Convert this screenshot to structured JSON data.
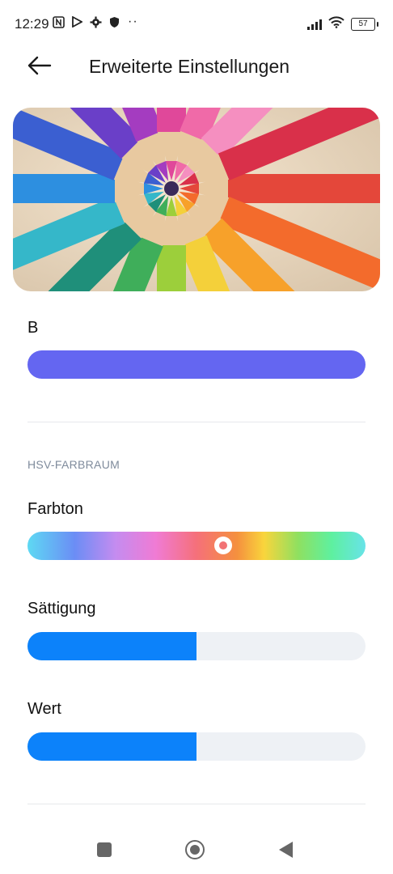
{
  "status_bar": {
    "time": "12:29",
    "icons_left": [
      "nfc-icon",
      "play-icon",
      "settings-icon",
      "shield-icon"
    ],
    "dots": "··",
    "battery": "57"
  },
  "header": {
    "title": "Erweiterte Einstellungen"
  },
  "colors": {
    "b_bar": "#6466f1",
    "accent": "#0c82fa",
    "track": "#eef1f5",
    "section_label": "#7f8b9c"
  },
  "channel_b": {
    "label": "B",
    "value_fraction": 1.0
  },
  "hsv_section": {
    "title": "HSV-FARBRAUM",
    "hue": {
      "label": "Farbton",
      "position_fraction": 0.5
    },
    "saturation": {
      "label": "Sättigung",
      "value_fraction": 0.5
    },
    "value": {
      "label": "Wert",
      "value_fraction": 0.5
    }
  },
  "navbar": {
    "buttons": [
      "recent-apps",
      "home",
      "back"
    ]
  }
}
